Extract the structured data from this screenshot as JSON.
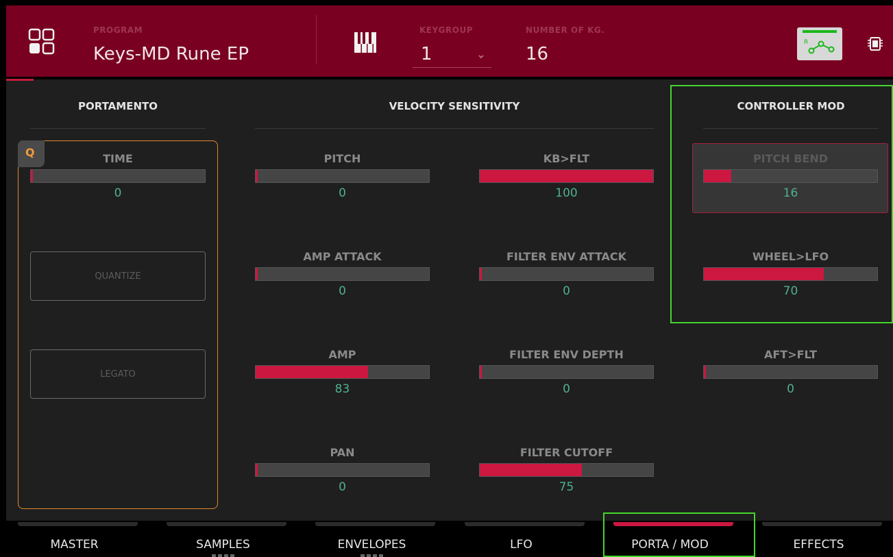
{
  "header": {
    "program_label": "PROGRAM",
    "program_name": "Keys-MD Rune EP",
    "keygroup_label": "KEYGROUP",
    "keygroup_value": "1",
    "num_kg_label": "NUMBER OF KG.",
    "num_kg_value": "16",
    "icons": [
      "pads-grid-icon",
      "piano-keys-icon",
      "chevron-down-icon",
      "routing-icon",
      "chip-icon"
    ]
  },
  "portamento": {
    "title": "PORTAMENTO",
    "badge": "Q",
    "time_label": "TIME",
    "time_value": "0",
    "time_fraction": 0.0,
    "quantize_label": "QUANTIZE",
    "legato_label": "LEGATO"
  },
  "velocity": {
    "title": "VELOCITY SENSITIVITY",
    "params": [
      {
        "label": "PITCH",
        "value": "0",
        "fraction": 0.0
      },
      {
        "label": "KB>FLT",
        "value": "100",
        "fraction": 1.0
      },
      {
        "label": "AMP ATTACK",
        "value": "0",
        "fraction": 0.0
      },
      {
        "label": "FILTER ENV ATTACK",
        "value": "0",
        "fraction": 0.0
      },
      {
        "label": "AMP",
        "value": "83",
        "fraction": 0.65
      },
      {
        "label": "FILTER ENV DEPTH",
        "value": "0",
        "fraction": 0.0
      },
      {
        "label": "PAN",
        "value": "0",
        "fraction": 0.0
      },
      {
        "label": "FILTER CUTOFF",
        "value": "75",
        "fraction": 0.59
      }
    ]
  },
  "controller": {
    "title": "CONTROLLER MOD",
    "params": [
      {
        "label": "PITCH BEND",
        "value": "16",
        "fraction": 0.16
      },
      {
        "label": "WHEEL>LFO",
        "value": "70",
        "fraction": 0.69
      },
      {
        "label": "AFT>FLT",
        "value": "0",
        "fraction": 0.0
      }
    ]
  },
  "tabs": [
    {
      "label": "MASTER"
    },
    {
      "label": "SAMPLES"
    },
    {
      "label": "ENVELOPES"
    },
    {
      "label": "LFO"
    },
    {
      "label": "PORTA / MOD"
    },
    {
      "label": "EFFECTS"
    }
  ],
  "colors": {
    "header_bg": "#7a0022",
    "accent_red": "#cc1740",
    "value_green": "#4fb08e",
    "portamento_orange": "#e08a2c",
    "highlight_green": "#44d62c"
  }
}
